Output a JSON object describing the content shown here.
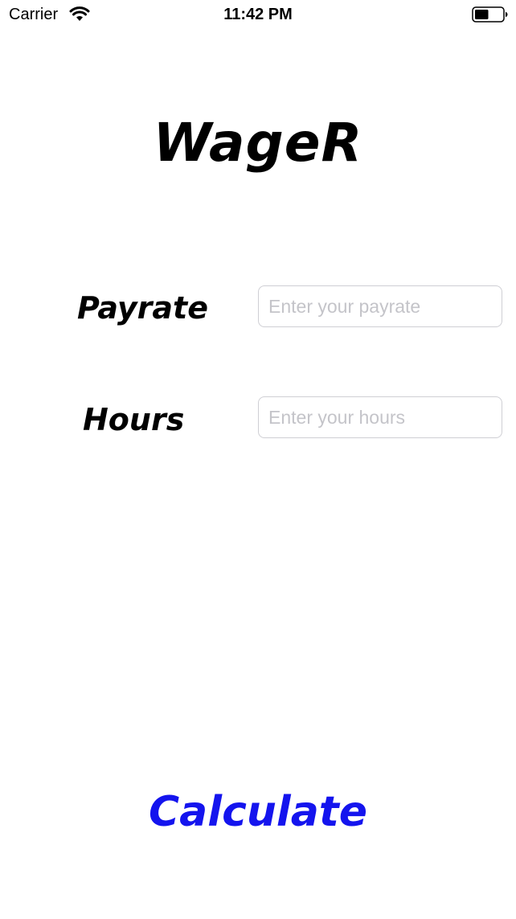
{
  "status_bar": {
    "carrier": "Carrier",
    "time": "11:42 PM",
    "wifi_icon": "wifi-icon",
    "battery_icon": "battery-icon",
    "battery_level": 0.5
  },
  "app": {
    "title": "WageR",
    "payrate": {
      "label": "Payrate",
      "value": "",
      "placeholder": "Enter your payrate"
    },
    "hours": {
      "label": "Hours",
      "value": "",
      "placeholder": "Enter your hours"
    },
    "calculate_label": "Calculate"
  },
  "colors": {
    "background": "#ffffff",
    "text": "#000000",
    "accent": "#1414ee",
    "placeholder": "#c4c4c9",
    "input_border": "#cfcfd4"
  }
}
